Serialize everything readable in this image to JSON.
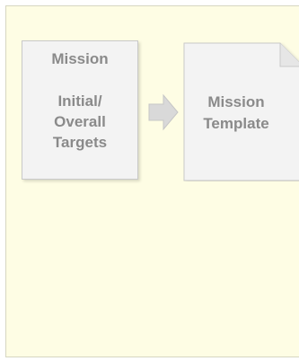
{
  "diagram": {
    "source_box": {
      "title": "Mission",
      "body": "Initial/\nOverall\nTargets"
    },
    "target_doc": {
      "label": "Mission\nTemplate"
    },
    "connector": "arrow-right"
  },
  "colors": {
    "panel_background": "#fefde4",
    "box_fill": "#f3f3f3",
    "text": "#8a8a8a",
    "arrow_fill": "#d9d9d9"
  }
}
